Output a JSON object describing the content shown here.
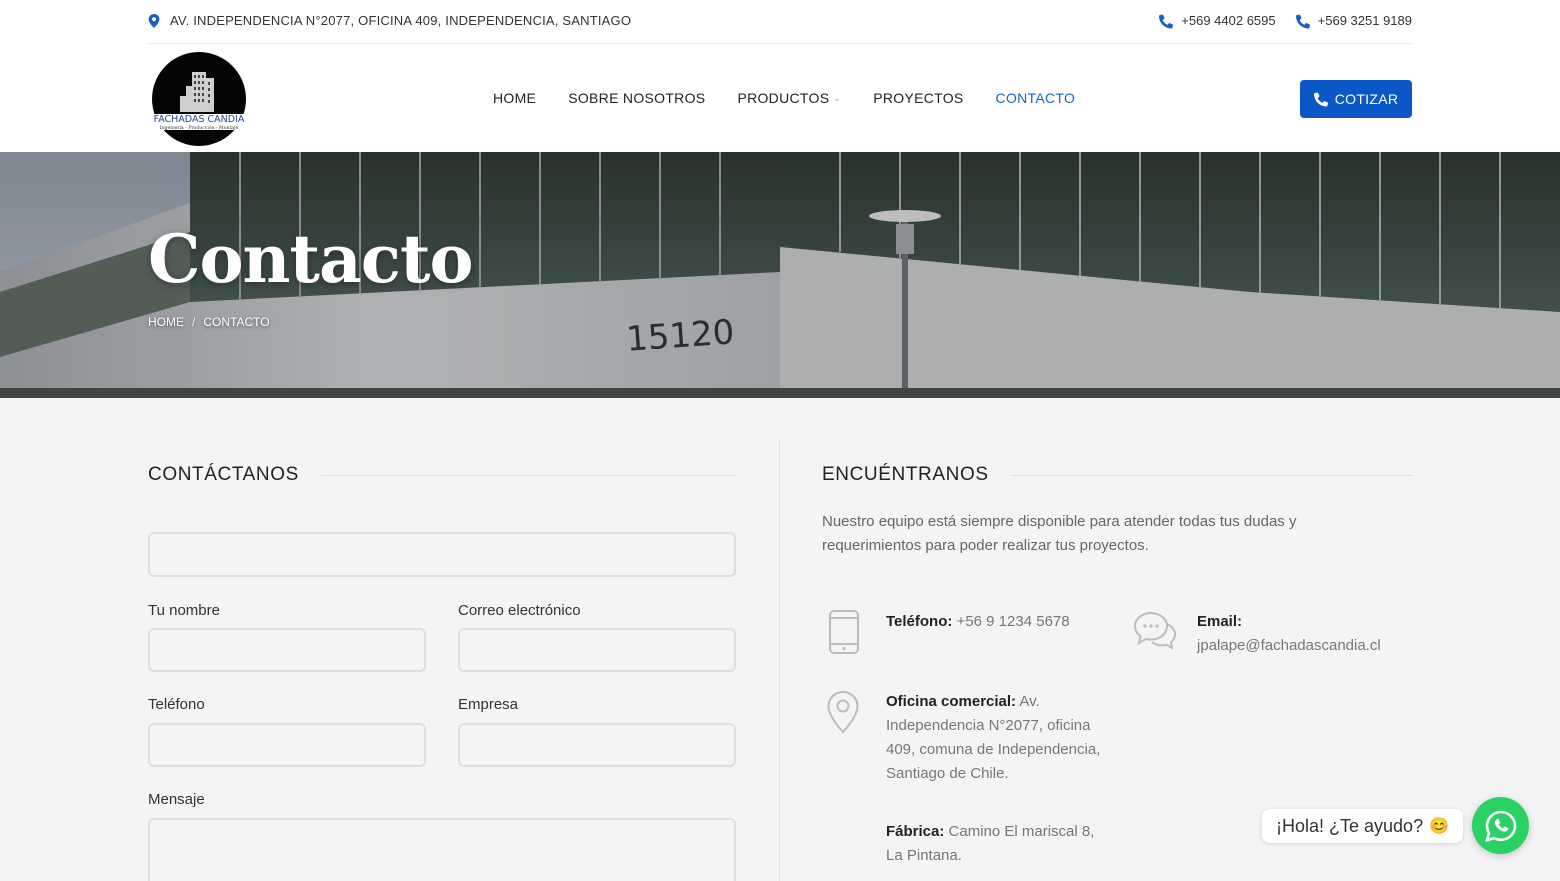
{
  "topbar": {
    "address": "AV. INDEPENDENCIA N°2077, OFICINA 409, INDEPENDENCIA, SANTIAGO",
    "phone1": "+569 4402 6595",
    "phone2": "+569 3251 9189"
  },
  "logo": {
    "name": "FACHADAS CANDIA",
    "tagline": "Ingeniería - Producción - Montaje"
  },
  "nav": {
    "items": [
      "HOME",
      "SOBRE NOSOTROS",
      "PRODUCTOS",
      "PROYECTOS",
      "CONTACTO"
    ],
    "active": "CONTACTO"
  },
  "cta": {
    "label": "COTIZAR"
  },
  "hero": {
    "title": "Contacto",
    "building_number": "15120",
    "breadcrumb": {
      "home": "HOME",
      "separator": "/",
      "current": "CONTACTO"
    }
  },
  "contact_form": {
    "heading": "CONTÁCTANOS",
    "labels": {
      "name": "Tu nombre",
      "email": "Correo electrónico",
      "phone": "Teléfono",
      "company": "Empresa",
      "message": "Mensaje"
    }
  },
  "find_us": {
    "heading": "ENCUÉNTRANOS",
    "intro": "Nuestro equipo está siempre disponible para atender todas tus dudas y requerimientos para poder realizar tus proyectos.",
    "phone_label": "Teléfono:",
    "phone_value": "+56 9 1234 5678",
    "email_label": "Email:",
    "email_value": "jpalape@fachadascandia.cl",
    "office_label": "Oficina comercial:",
    "office_value": "Av. Independencia N°2077, oficina 409, comuna de Independencia, Santiago de Chile.",
    "factory_label": "Fábrica:",
    "factory_value": "Camino El mariscal 8, La Pintana."
  },
  "whatsapp": {
    "bubble": "¡Hola! ¿Te ayudo?",
    "emoji": "😊"
  },
  "colors": {
    "accent": "#0a57c7",
    "whatsapp": "#2ad266",
    "active_nav": "#1565c0"
  }
}
